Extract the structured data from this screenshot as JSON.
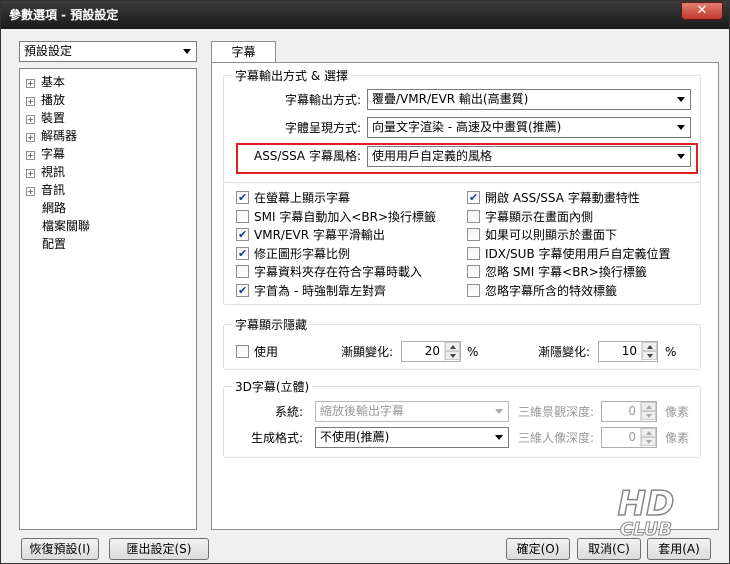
{
  "window": {
    "title": "參數選項 - 預設設定",
    "close_icon": "close-icon"
  },
  "profile_select": "預設設定",
  "tree": {
    "items": [
      {
        "label": "基本",
        "expandable": true
      },
      {
        "label": "播放",
        "expandable": true
      },
      {
        "label": "裝置",
        "expandable": true
      },
      {
        "label": "解碼器",
        "expandable": true
      },
      {
        "label": "字幕",
        "expandable": true
      },
      {
        "label": "視訊",
        "expandable": true
      },
      {
        "label": "音訊",
        "expandable": true
      },
      {
        "label": "網路",
        "expandable": false
      },
      {
        "label": "檔案關聯",
        "expandable": false
      },
      {
        "label": "配置",
        "expandable": false
      }
    ]
  },
  "tab": {
    "label": "字幕"
  },
  "output_group": {
    "title": "字幕輸出方式 & 選擇",
    "output_mode_label": "字幕輸出方式:",
    "output_mode_value": "覆疊/VMR/EVR 輸出(高畫質)",
    "font_render_label": "字體呈現方式:",
    "font_render_value": "向量文字渲染 - 高速及中畫質(推薦)",
    "ass_style_label": "ASS/SSA 字幕風格:",
    "ass_style_value": "使用用戶自定義的風格"
  },
  "checkboxes_left": [
    {
      "label": "在螢幕上顯示字幕",
      "checked": true
    },
    {
      "label": "SMI 字幕自動加入<BR>換行標籤",
      "checked": false
    },
    {
      "label": "VMR/EVR 字幕平滑輸出",
      "checked": true
    },
    {
      "label": "修正圖形字幕比例",
      "checked": true
    },
    {
      "label": "字幕資料夾存在符合字幕時載入",
      "checked": false
    },
    {
      "label": "字首為 - 時強制靠左對齊",
      "checked": true
    }
  ],
  "checkboxes_right": [
    {
      "label": "開啟 ASS/SSA 字幕動畫特性",
      "checked": true
    },
    {
      "label": "字幕顯示在畫面內側",
      "checked": false
    },
    {
      "label": "如果可以則顯示於畫面下",
      "checked": false
    },
    {
      "label": "IDX/SUB 字幕使用用戶自定義位置",
      "checked": false
    },
    {
      "label": "忽略 SMI 字幕<BR>換行標籤",
      "checked": false
    },
    {
      "label": "忽略字幕所含的特效標籤",
      "checked": false
    }
  ],
  "fade_group": {
    "title": "字幕顯示隱藏",
    "use_label": "使用",
    "use_checked": false,
    "fade_in_label": "漸顯變化:",
    "fade_in_value": "20",
    "fade_out_label": "漸隱變化:",
    "fade_out_value": "10",
    "unit": "%"
  },
  "group_3d": {
    "title": "3D字幕(立體)",
    "system_label": "系統:",
    "system_value": "縮放後輸出字幕",
    "format_label": "生成格式:",
    "format_value": "不使用(推薦)",
    "depth_label": "三維景觀深度:",
    "depth_value": "0",
    "person_depth_label": "三維人像深度:",
    "person_depth_value": "0",
    "pixel_unit": "像素"
  },
  "buttons": {
    "reset": "恢復預設(I)",
    "export": "匯出設定(S)",
    "ok": "確定(O)",
    "cancel": "取消(C)",
    "apply": "套用(A)"
  },
  "watermark": {
    "text": "HD CLUB",
    "url": "www.hd.club.tw"
  }
}
